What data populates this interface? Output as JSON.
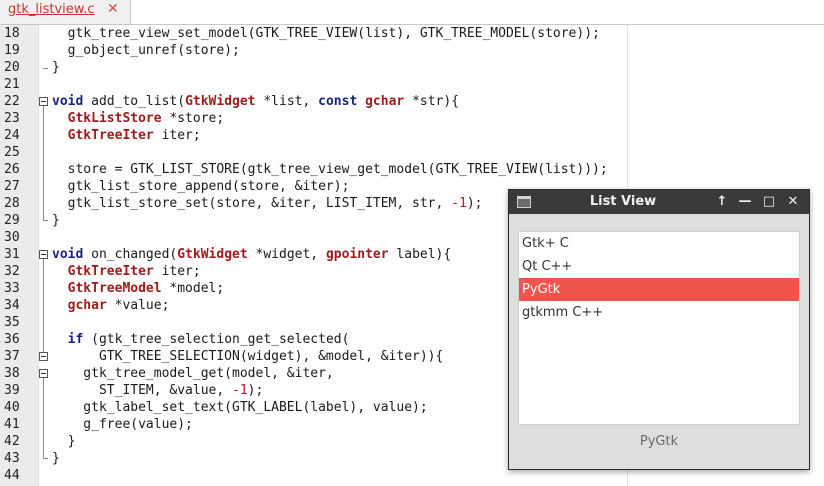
{
  "editor": {
    "tab_label": "gtk_listview.c",
    "tab_close": "✕",
    "lines": [
      {
        "n": "18",
        "tokens": [
          [
            "p",
            "  gtk_tree_view_set_model(GTK_TREE_VIEW(list), GTK_TREE_MODEL(store));"
          ]
        ]
      },
      {
        "n": "19",
        "tokens": [
          [
            "p",
            "  g_object_unref(store);"
          ]
        ]
      },
      {
        "n": "20",
        "tokens": [
          [
            "p",
            "}"
          ]
        ]
      },
      {
        "n": "21",
        "tokens": []
      },
      {
        "n": "22",
        "tokens": [
          [
            "k",
            "void"
          ],
          [
            "p",
            " add_to_list("
          ],
          [
            "t",
            "GtkWidget"
          ],
          [
            "p",
            " *list, "
          ],
          [
            "k",
            "const"
          ],
          [
            "p",
            " "
          ],
          [
            "t",
            "gchar"
          ],
          [
            "p",
            " *str){"
          ]
        ]
      },
      {
        "n": "23",
        "tokens": [
          [
            "p",
            "  "
          ],
          [
            "t",
            "GtkListStore"
          ],
          [
            "p",
            " *store;"
          ]
        ]
      },
      {
        "n": "24",
        "tokens": [
          [
            "p",
            "  "
          ],
          [
            "t",
            "GtkTreeIter"
          ],
          [
            "p",
            " iter;"
          ]
        ]
      },
      {
        "n": "25",
        "tokens": []
      },
      {
        "n": "26",
        "tokens": [
          [
            "p",
            "  store = GTK_LIST_STORE(gtk_tree_view_get_model(GTK_TREE_VIEW(list)));"
          ]
        ]
      },
      {
        "n": "27",
        "tokens": [
          [
            "p",
            "  gtk_list_store_append(store, &iter);"
          ]
        ]
      },
      {
        "n": "28",
        "tokens": [
          [
            "p",
            "  gtk_list_store_set(store, &iter, LIST_ITEM, str, "
          ],
          [
            "n",
            "-1"
          ],
          [
            "p",
            ");"
          ]
        ]
      },
      {
        "n": "29",
        "tokens": [
          [
            "p",
            "}"
          ]
        ]
      },
      {
        "n": "30",
        "tokens": []
      },
      {
        "n": "31",
        "tokens": [
          [
            "k",
            "void"
          ],
          [
            "p",
            " on_changed("
          ],
          [
            "t",
            "GtkWidget"
          ],
          [
            "p",
            " *widget, "
          ],
          [
            "t",
            "gpointer"
          ],
          [
            "p",
            " label){"
          ]
        ]
      },
      {
        "n": "32",
        "tokens": [
          [
            "p",
            "  "
          ],
          [
            "t",
            "GtkTreeIter"
          ],
          [
            "p",
            " iter;"
          ]
        ]
      },
      {
        "n": "33",
        "tokens": [
          [
            "p",
            "  "
          ],
          [
            "t",
            "GtkTreeModel"
          ],
          [
            "p",
            " *model;"
          ]
        ]
      },
      {
        "n": "34",
        "tokens": [
          [
            "p",
            "  "
          ],
          [
            "t",
            "gchar"
          ],
          [
            "p",
            " *value;"
          ]
        ]
      },
      {
        "n": "35",
        "tokens": []
      },
      {
        "n": "36",
        "tokens": [
          [
            "p",
            "  "
          ],
          [
            "k",
            "if"
          ],
          [
            "p",
            " (gtk_tree_selection_get_selected("
          ]
        ]
      },
      {
        "n": "37",
        "tokens": [
          [
            "p",
            "      GTK_TREE_SELECTION(widget), &model, &iter)){"
          ]
        ]
      },
      {
        "n": "38",
        "tokens": [
          [
            "p",
            "    gtk_tree_model_get(model, &iter,"
          ]
        ]
      },
      {
        "n": "39",
        "tokens": [
          [
            "p",
            "      ST_ITEM, &value, "
          ],
          [
            "n",
            "-1"
          ],
          [
            "p",
            ");"
          ]
        ]
      },
      {
        "n": "40",
        "tokens": [
          [
            "p",
            "    gtk_label_set_text(GTK_LABEL(label), value);"
          ]
        ]
      },
      {
        "n": "41",
        "tokens": [
          [
            "p",
            "    g_free(value);"
          ]
        ]
      },
      {
        "n": "42",
        "tokens": [
          [
            "p",
            "  }"
          ]
        ]
      },
      {
        "n": "43",
        "tokens": [
          [
            "p",
            "}"
          ]
        ]
      },
      {
        "n": "44",
        "tokens": []
      }
    ]
  },
  "dialog": {
    "title": "List View",
    "buttons": {
      "up": "↑",
      "minimize": "—",
      "maximize": "□",
      "close": "✕"
    },
    "items": [
      "Gtk+ C",
      "Qt C++",
      "PyGtk",
      "gtkmm C++"
    ],
    "selected_index": 2,
    "status_label": "PyGtk"
  },
  "colors": {
    "selection": "#f0544d",
    "type_color": "#9b1b1b",
    "keyword_color": "#1a237e",
    "number_color": "#b71c1c"
  }
}
